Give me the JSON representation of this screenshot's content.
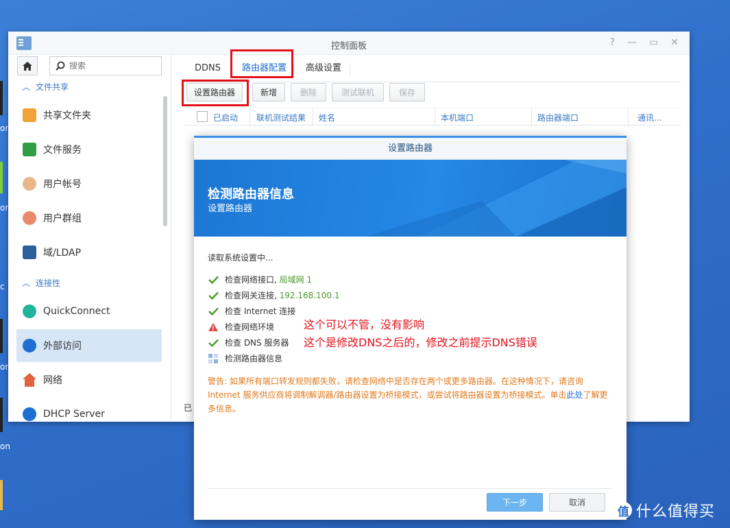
{
  "window": {
    "title": "控制面板",
    "controls": [
      "?",
      "—",
      "▭",
      "✕"
    ]
  },
  "sidebar": {
    "search_placeholder": "搜索",
    "sections": [
      {
        "label": "文件共享"
      },
      {
        "label": "连接性"
      }
    ],
    "items": [
      {
        "label": "共享文件夹",
        "icon": "shared-folder-icon"
      },
      {
        "label": "文件服务",
        "icon": "file-services-icon"
      },
      {
        "label": "用户帐号",
        "icon": "user-icon"
      },
      {
        "label": "用户群组",
        "icon": "group-icon"
      },
      {
        "label": "域/LDAP",
        "icon": "domain-ldap-icon"
      },
      {
        "label": "QuickConnect",
        "icon": "quickconnect-icon"
      },
      {
        "label": "外部访问",
        "icon": "external-access-icon",
        "active": true
      },
      {
        "label": "网络",
        "icon": "network-icon"
      },
      {
        "label": "DHCP Server",
        "icon": "dhcp-icon"
      }
    ]
  },
  "tabs": [
    "DDNS",
    "路由器配置",
    "高级设置"
  ],
  "active_tab": "路由器配置",
  "toolbar": {
    "setup": "设置路由器",
    "add": "新增",
    "delete": "删除",
    "test": "测试联机",
    "save": "保存"
  },
  "grid_headers": [
    "已启动",
    "联机测试结果",
    "姓名",
    "本机端口",
    "路由器端口",
    "通讯..."
  ],
  "status_text": "已",
  "dialog": {
    "title": "设置路由器",
    "banner_title": "检测路由器信息",
    "banner_subtitle": "设置路由器",
    "loading": "读取系统设置中...",
    "checks": [
      {
        "status": "ok",
        "text": "检查网络接口,",
        "value": "局域网 1"
      },
      {
        "status": "ok",
        "text": "检查网关连接,",
        "value": "192.168.100.1"
      },
      {
        "status": "ok",
        "text": "检查 Internet 连接",
        "value": ""
      },
      {
        "status": "warn",
        "text": "检查网络环境",
        "value": ""
      },
      {
        "status": "ok",
        "text": "检查 DNS 服务器",
        "value": ""
      },
      {
        "status": "pending",
        "text": "检测路由器信息",
        "value": ""
      }
    ],
    "warning_prefix": "警告: 如果所有端口转发规则都失败，请检查网络中是否存在两个或更多路由器。在这种情况下，请咨询 Internet 服务供应商将调制解调器/路由器设置为桥接模式，或尝试将路由器设置为桥接模式。单击",
    "warning_link": "此处",
    "warning_suffix": "了解更多信息。",
    "next": "下一步",
    "cancel": "取消"
  },
  "annotations": {
    "line1": "这个可以不管，没有影响",
    "line2": "这个是修改DNS之后的，修改之前提示DNS错误"
  },
  "desktop_labels": [
    "on",
    "on",
    "c",
    "on",
    "on"
  ],
  "watermark": {
    "badge": "值",
    "text": "什么值得买"
  },
  "colors": {
    "accent": "#1e6fd1",
    "highlight": "#e5101c",
    "warning": "#e07a1f",
    "ok": "#4a9a2a"
  }
}
